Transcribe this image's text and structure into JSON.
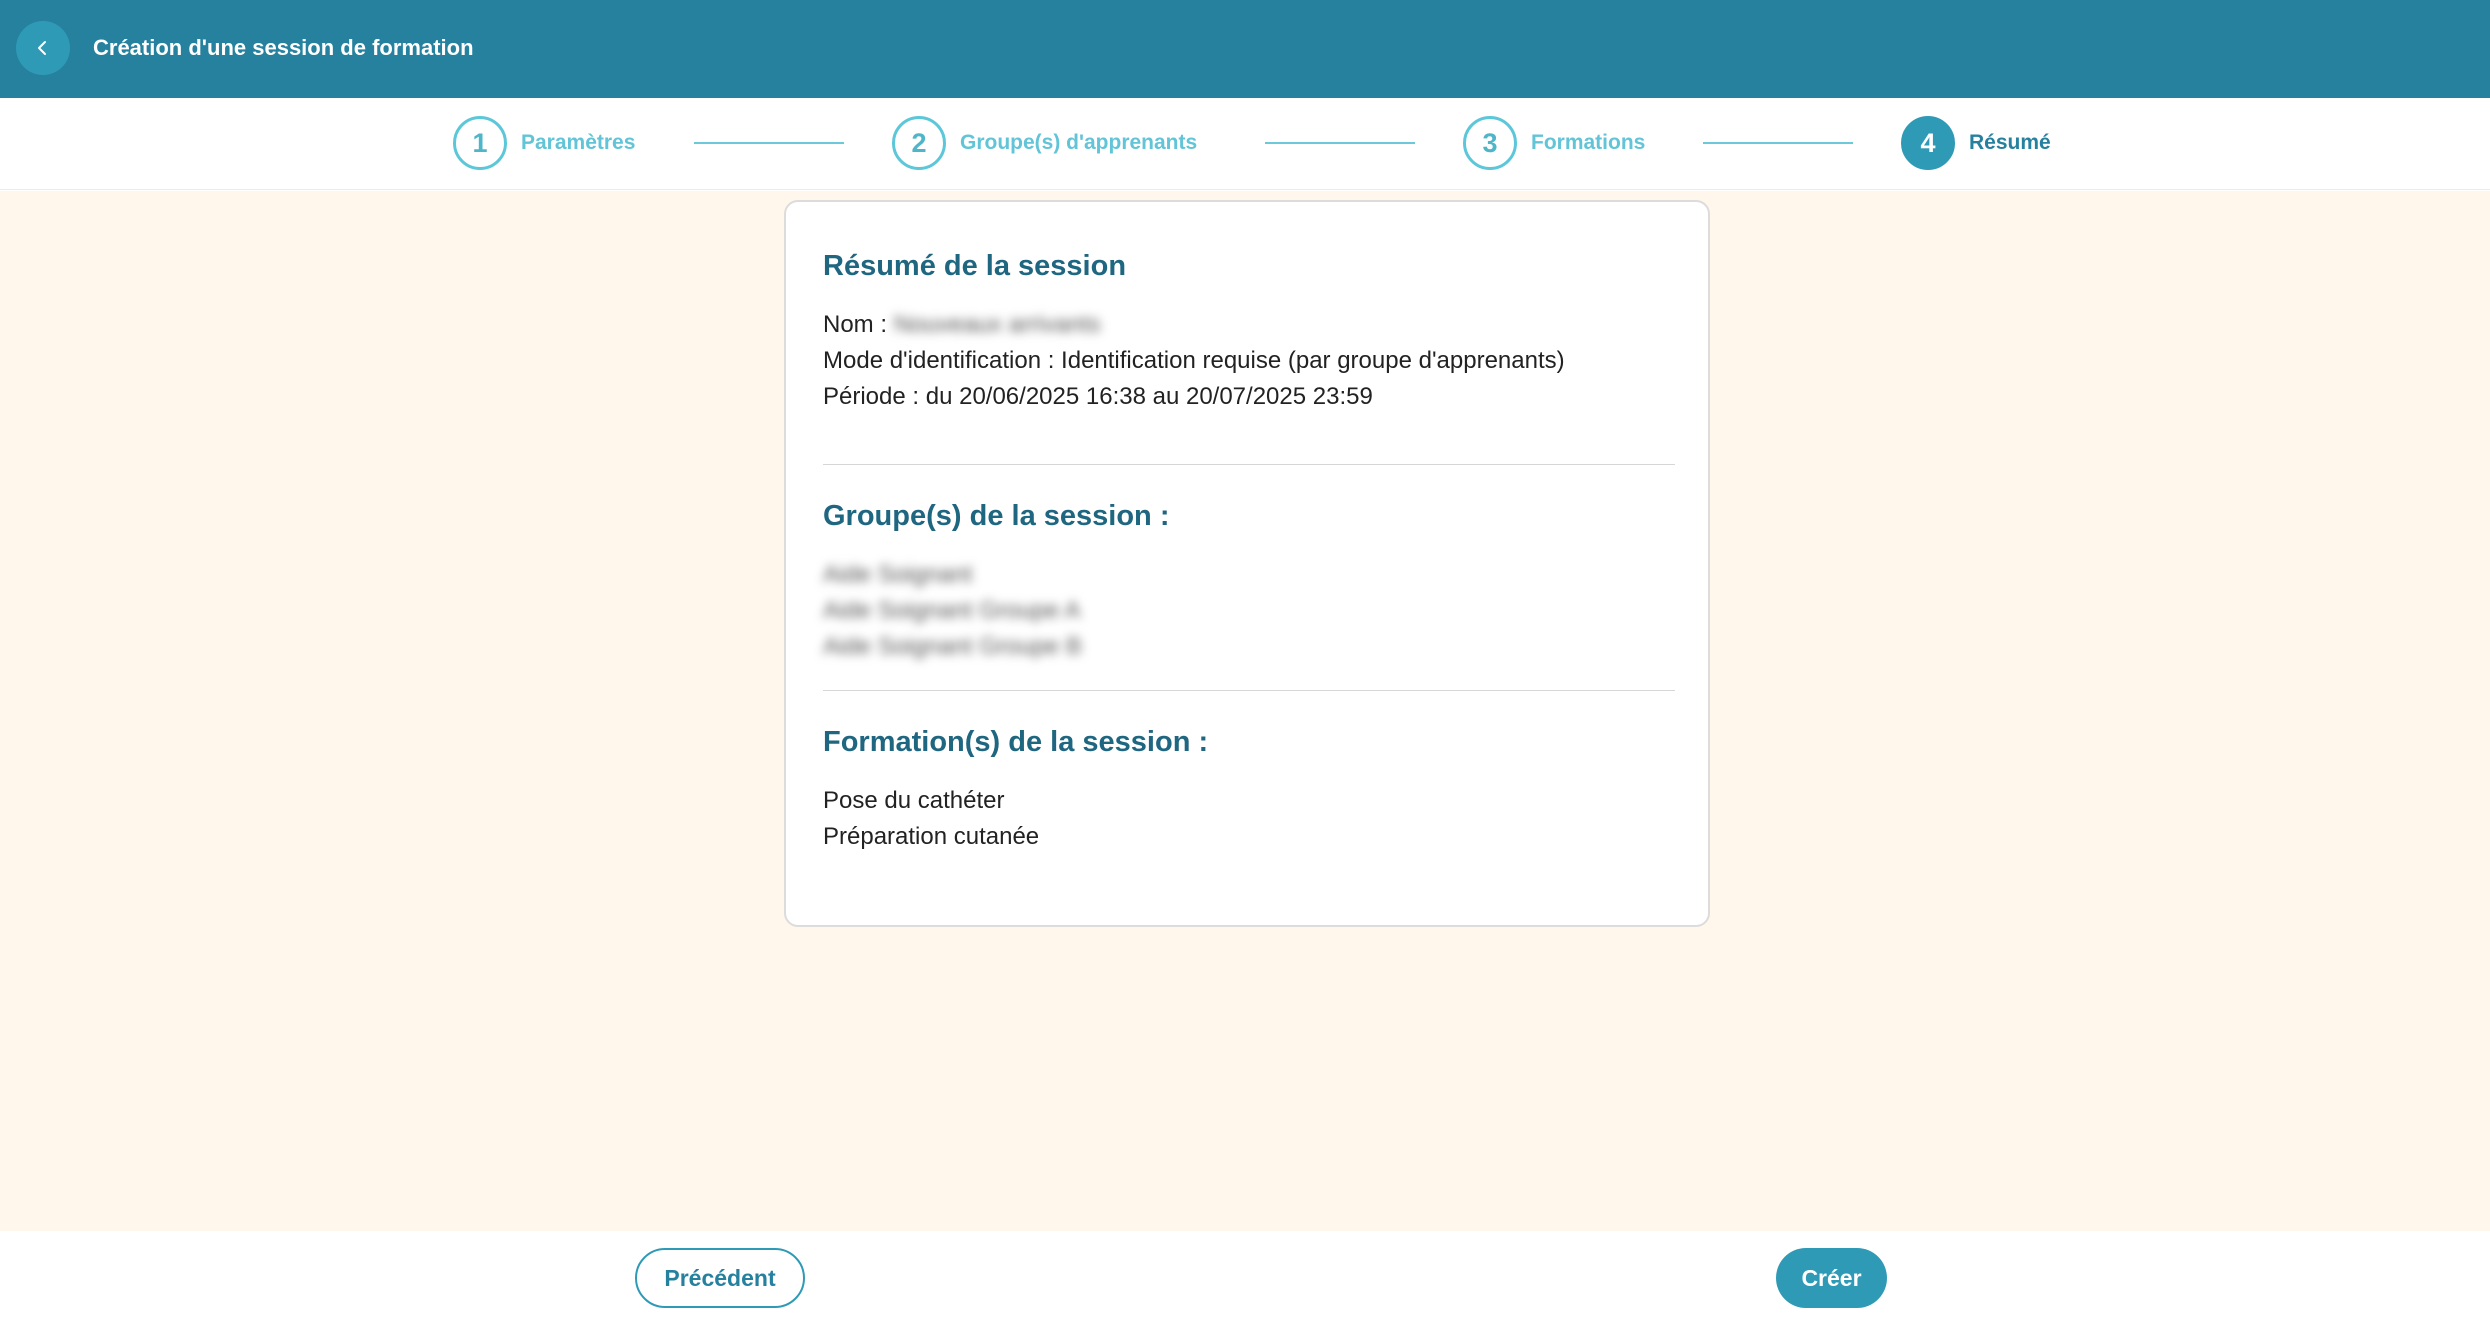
{
  "header": {
    "title": "Création d'une session de formation",
    "back_icon": "chevron-left-icon"
  },
  "stepper": {
    "steps": [
      {
        "number": "1",
        "label": "Paramètres",
        "active": false
      },
      {
        "number": "2",
        "label": "Groupe(s) d'apprenants",
        "active": false
      },
      {
        "number": "3",
        "label": "Formations",
        "active": false
      },
      {
        "number": "4",
        "label": "Résumé",
        "active": true
      }
    ]
  },
  "summary": {
    "title": "Résumé de la session",
    "name_label": "Nom :",
    "name_value": "Nouveaux arrivants",
    "mode_line": "Mode d'identification : Identification requise (par groupe d'apprenants)",
    "period_line": "Période : du 20/06/2025 16:38 au 20/07/2025 23:59"
  },
  "groups": {
    "title": "Groupe(s) de la session :",
    "items": [
      "Aide Soignant",
      "Aide Soignant Groupe A",
      "Aide Soignant Groupe B"
    ]
  },
  "trainings": {
    "title": "Formation(s) de la session :",
    "items": [
      "Pose du cathéter",
      "Préparation cutanée"
    ]
  },
  "footer": {
    "prev_label": "Précédent",
    "create_label": "Créer"
  },
  "colors": {
    "header_bg": "#25819e",
    "accent": "#2e9ab6",
    "step_inactive": "#62c4d7",
    "page_bg": "#fff6ec",
    "title_text": "#1f6680"
  }
}
